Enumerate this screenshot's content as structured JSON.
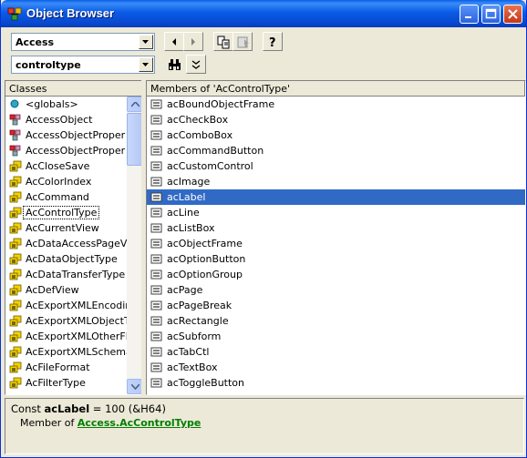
{
  "window": {
    "title": "Object Browser"
  },
  "toolbar": {
    "library_value": "Access",
    "search_value": "controltype",
    "buttons": [
      "back-icon",
      "forward-icon",
      "copy-icon",
      "view-definition-icon",
      "help-icon",
      "binoculars-icon",
      "show-hide-results-icon"
    ]
  },
  "classes": {
    "header": "Classes",
    "items": [
      {
        "label": "<globals>",
        "icon": "globals-icon"
      },
      {
        "label": "AccessObject",
        "icon": "class-icon"
      },
      {
        "label": "AccessObjectProper",
        "icon": "class-icon"
      },
      {
        "label": "AccessObjectProper",
        "icon": "class-icon"
      },
      {
        "label": "AcCloseSave",
        "icon": "enum-icon"
      },
      {
        "label": "AcColorIndex",
        "icon": "enum-icon"
      },
      {
        "label": "AcCommand",
        "icon": "enum-icon"
      },
      {
        "label": "AcControlType",
        "icon": "enum-icon"
      },
      {
        "label": "AcCurrentView",
        "icon": "enum-icon"
      },
      {
        "label": "AcDataAccessPageV",
        "icon": "enum-icon"
      },
      {
        "label": "AcDataObjectType",
        "icon": "enum-icon"
      },
      {
        "label": "AcDataTransferType",
        "icon": "enum-icon"
      },
      {
        "label": "AcDefView",
        "icon": "enum-icon"
      },
      {
        "label": "AcExportXMLEncodir",
        "icon": "enum-icon"
      },
      {
        "label": "AcExportXMLObjectT",
        "icon": "enum-icon"
      },
      {
        "label": "AcExportXMLOtherFl",
        "icon": "enum-icon"
      },
      {
        "label": "AcExportXMLSchema",
        "icon": "enum-icon"
      },
      {
        "label": "AcFileFormat",
        "icon": "enum-icon"
      },
      {
        "label": "AcFilterType",
        "icon": "enum-icon"
      }
    ],
    "selected": "AcControlType"
  },
  "members": {
    "header": "Members of 'AcControlType'",
    "items": [
      "acBoundObjectFrame",
      "acCheckBox",
      "acComboBox",
      "acCommandButton",
      "acCustomControl",
      "acImage",
      "acLabel",
      "acLine",
      "acListBox",
      "acObjectFrame",
      "acOptionButton",
      "acOptionGroup",
      "acPage",
      "acPageBreak",
      "acRectangle",
      "acSubform",
      "acTabCtl",
      "acTextBox",
      "acToggleButton"
    ],
    "selected": "acLabel"
  },
  "details": {
    "const_prefix": "Const ",
    "const_name": "acLabel",
    "const_value": " = 100 (&H64)",
    "member_of_prefix": "Member of ",
    "library_link": "Access",
    "dot": ".",
    "class_link": "AcControlType"
  },
  "colors": {
    "selection": "#316ac5",
    "titlebar": "#0a5be6",
    "link": "#007f00"
  }
}
